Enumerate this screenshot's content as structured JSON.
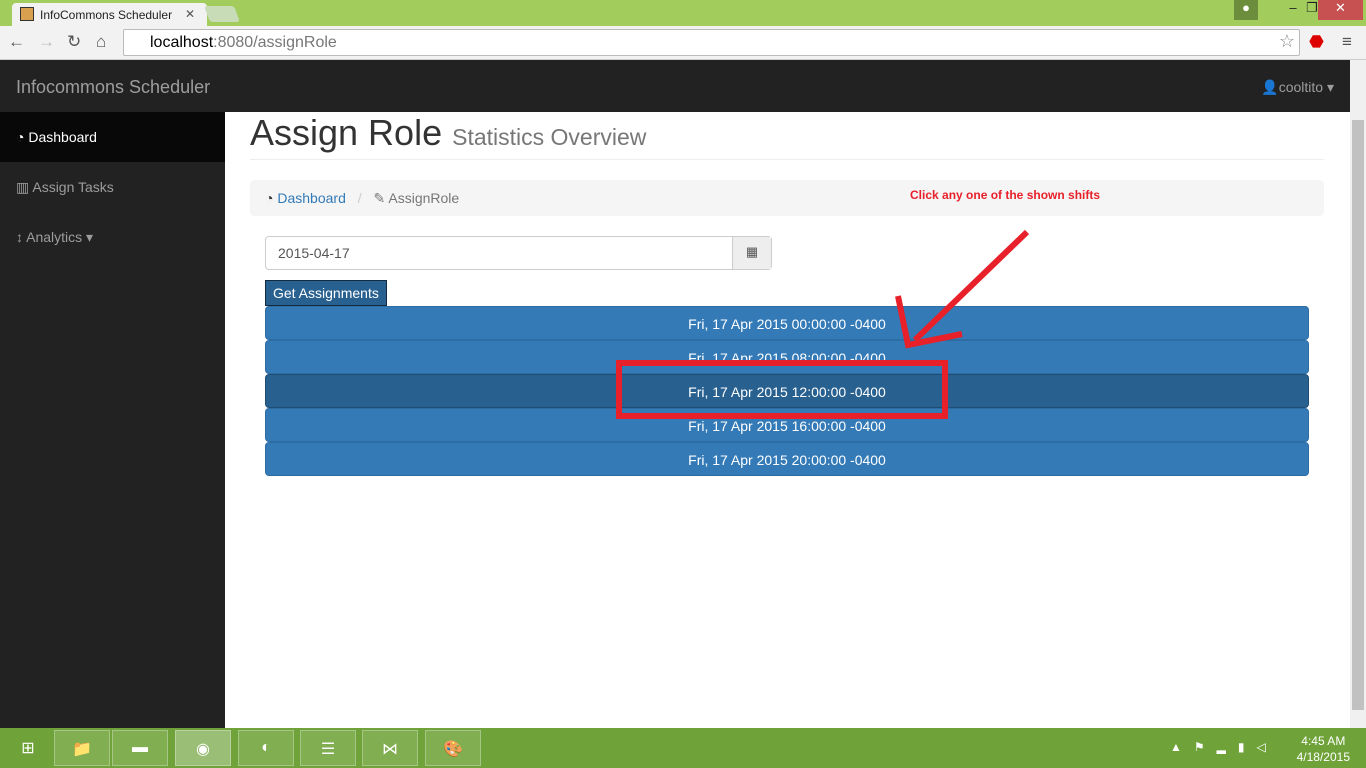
{
  "browser": {
    "tab_title": "InfoCommons Scheduler",
    "url_host": "localhost",
    "url_rest": ":8080/assignRole"
  },
  "app": {
    "brand": "Infocommons Scheduler",
    "user": "cooltito"
  },
  "sidebar": {
    "items": [
      {
        "label": "Dashboard",
        "icon": "dashboard-icon",
        "active": true
      },
      {
        "label": "Assign Tasks",
        "icon": "bar-chart-icon"
      },
      {
        "label": "Analytics",
        "icon": "vertical-arrows-icon"
      }
    ]
  },
  "page": {
    "title": "Assign Role",
    "subtitle": "Statistics Overview"
  },
  "breadcrumb": {
    "home": "Dashboard",
    "current": "AssignRole",
    "separator": "/"
  },
  "annotation": {
    "text": "Click any one of the shown shifts",
    "color": "#e8202a"
  },
  "form": {
    "date": "2015-04-17",
    "button": "Get Assignments"
  },
  "shifts": [
    "Fri, 17 Apr 2015 00:00:00 -0400",
    "Fri, 17 Apr 2015 08:00:00 -0400",
    "Fri, 17 Apr 2015 12:00:00 -0400",
    "Fri, 17 Apr 2015 16:00:00 -0400",
    "Fri, 17 Apr 2015 20:00:00 -0400"
  ],
  "selected_shift": 2,
  "taskbar": {
    "time": "4:45 AM",
    "date": "4/18/2015"
  }
}
